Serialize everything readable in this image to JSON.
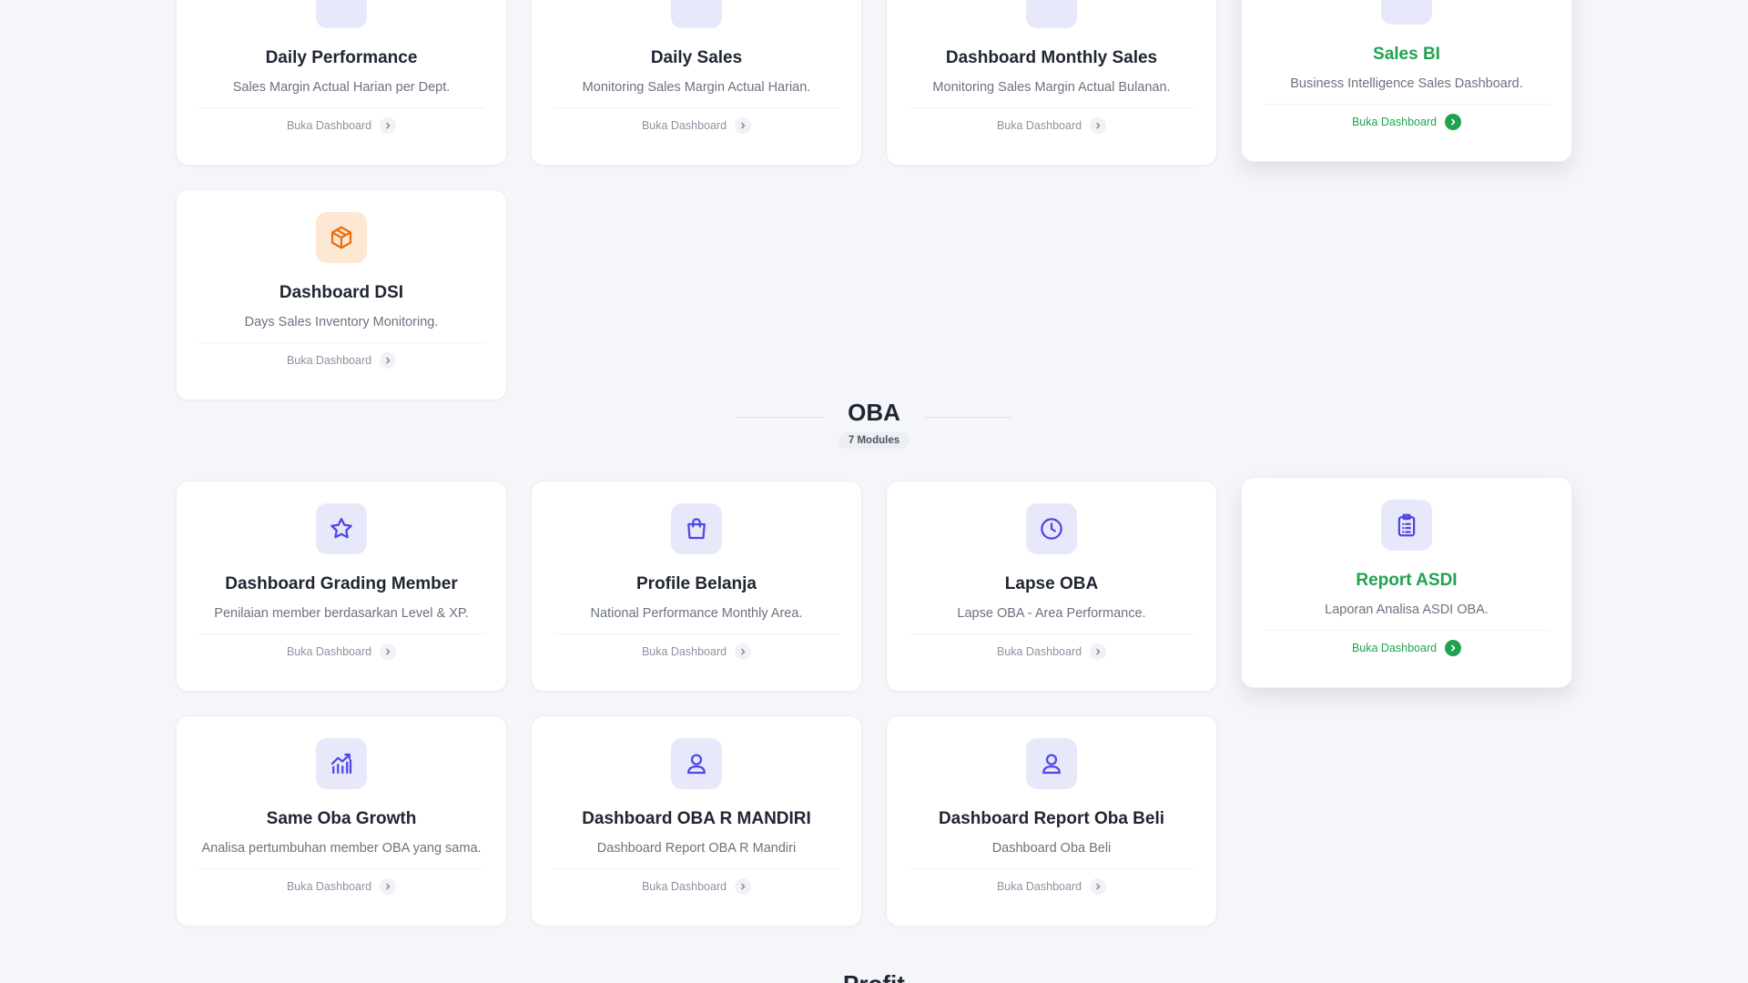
{
  "colors": {
    "accent_green": "#20a34f",
    "icon_indigo": "#4f46e5",
    "icon_orange": "#ea6c0b",
    "background": "#f5f6f9"
  },
  "top_section": {
    "cards": [
      {
        "title": "Daily Performance",
        "description": "Sales Margin Actual Harian per Dept.",
        "link": "Buka Dashboard"
      },
      {
        "title": "Daily Sales",
        "description": "Monitoring Sales Margin Actual Harian.",
        "link": "Buka Dashboard"
      },
      {
        "title": "Dashboard Monthly Sales",
        "description": "Monitoring Sales Margin Actual Bulanan.",
        "link": "Buka Dashboard"
      },
      {
        "title": "Sales BI",
        "description": "Business Intelligence Sales Dashboard.",
        "link": "Buka Dashboard"
      },
      {
        "title": "Dashboard DSI",
        "description": "Days Sales Inventory Monitoring.",
        "link": "Buka Dashboard",
        "icon": "cube-icon"
      }
    ]
  },
  "oba_section": {
    "title": "OBA",
    "count": "7 Modules",
    "cards": [
      {
        "title": "Dashboard Grading Member",
        "description": "Penilaian member berdasarkan Level & XP.",
        "link": "Buka Dashboard",
        "icon": "star-icon"
      },
      {
        "title": "Profile Belanja",
        "description": "National Performance Monthly Area.",
        "link": "Buka Dashboard",
        "icon": "shopping-bag-icon"
      },
      {
        "title": "Lapse OBA",
        "description": "Lapse OBA - Area Performance.",
        "link": "Buka Dashboard",
        "icon": "clock-icon"
      },
      {
        "title": "Report ASDI",
        "description": "Laporan Analisa ASDI OBA.",
        "link": "Buka Dashboard",
        "icon": "clipboard-icon"
      },
      {
        "title": "Same Oba Growth",
        "description": "Analisa pertumbuhan member OBA yang sama.",
        "link": "Buka Dashboard",
        "icon": "growth-chart-icon"
      },
      {
        "title": "Dashboard OBA R MANDIRI",
        "description": "Dashboard Report OBA R Mandiri",
        "link": "Buka Dashboard",
        "icon": "user-icon"
      },
      {
        "title": "Dashboard Report Oba Beli",
        "description": "Dashboard Oba Beli",
        "link": "Buka Dashboard",
        "icon": "user-icon"
      }
    ]
  },
  "next_section": {
    "title": "Profit"
  }
}
